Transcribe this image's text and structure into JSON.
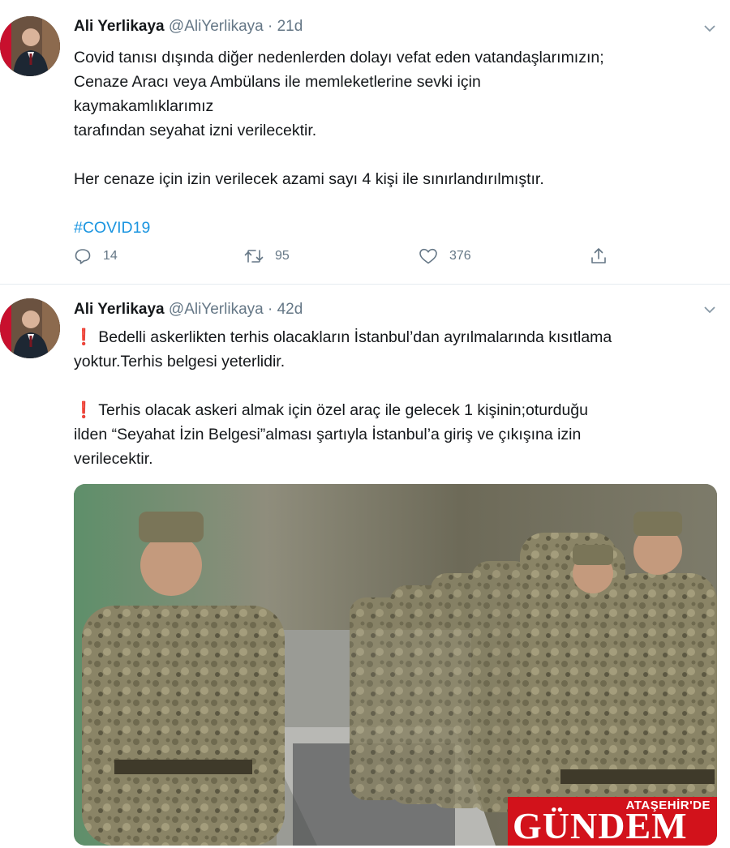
{
  "tweets": [
    {
      "name": "Ali Yerlikaya",
      "handle": "@AliYerlikaya",
      "sep": "·",
      "time": "21d",
      "lines": [
        "Covid tanısı dışında diğer nedenlerden dolayı vefat eden vatandaşlarımızın;",
        "Cenaze Aracı veya Ambülans ile memleketlerine sevki için",
        "kaymakamlıklarımız",
        "tarafından seyahat izni verilecektir.",
        "Her cenaze için izin verilecek azami sayı 4 kişi ile sınırlandırılmıştır."
      ],
      "hashtag": "#COVID19",
      "replies": "14",
      "retweets": "95",
      "likes": "376"
    },
    {
      "name": "Ali Yerlikaya",
      "handle": "@AliYerlikaya",
      "sep": "·",
      "time": "42d",
      "excl": "❗",
      "para1_line1": "Bedelli askerlikten terhis olacakların İstanbul’dan ayrılmalarında kısıtlama",
      "para1_line2": "yoktur.Terhis belgesi yeterlidir.",
      "para2_line1": "Terhis olacak askeri almak için özel araç ile gelecek 1 kişinin;oturduğu",
      "para2_line2": "ilden “Seyahat İzin Belgesi”alması şartıyla İstanbul’a giriş ve çıkışına izin",
      "para2_line3": "verilecektir."
    }
  ],
  "watermark": {
    "top": "ATAŞEHİR'DE",
    "main": "GÜNDEM"
  },
  "colors": {
    "link": "#1b95e0",
    "muted": "#657786",
    "alert": "#e0245e",
    "watermark": "#d2121b"
  },
  "icons": [
    "chevron-down-icon",
    "reply-icon",
    "retweet-icon",
    "like-icon",
    "share-icon",
    "exclamation-icon"
  ]
}
